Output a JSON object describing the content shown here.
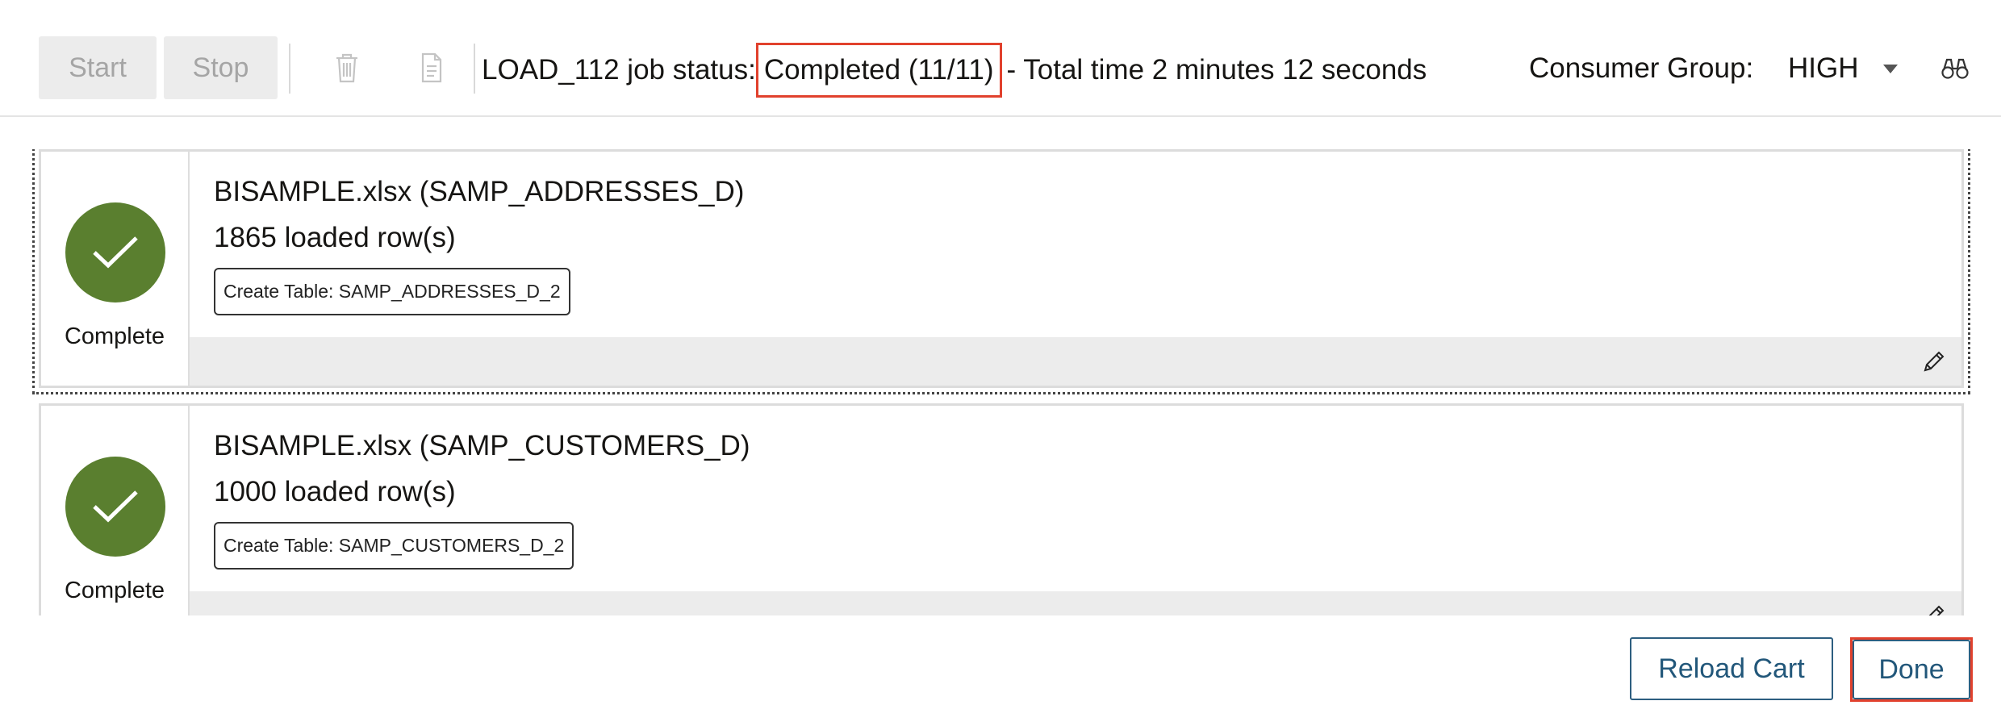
{
  "toolbar": {
    "start_label": "Start",
    "stop_label": "Stop",
    "delete_icon": "trash-icon",
    "report_icon": "document-icon",
    "status_prefix": "LOAD_112 job status:",
    "status_value": "Completed (11/11)",
    "status_suffix": "- Total time 2 minutes 12 seconds",
    "consumer_group_label": "Consumer Group:",
    "consumer_group_value": "HIGH",
    "search_icon": "binoculars-icon"
  },
  "jobs": [
    {
      "status": "Complete",
      "title": "BISAMPLE.xlsx (SAMP_ADDRESSES_D)",
      "rows": "1865 loaded row(s)",
      "tag": "Create Table: SAMP_ADDRESSES_D_2"
    },
    {
      "status": "Complete",
      "title": "BISAMPLE.xlsx (SAMP_CUSTOMERS_D)",
      "rows": "1000 loaded row(s)",
      "tag": "Create Table: SAMP_CUSTOMERS_D_2"
    }
  ],
  "actions": {
    "reload_label": "Reload Cart",
    "done_label": "Done"
  },
  "colors": {
    "success": "#5a7f2f",
    "highlight": "#e1412d",
    "button_text": "#22577a"
  }
}
